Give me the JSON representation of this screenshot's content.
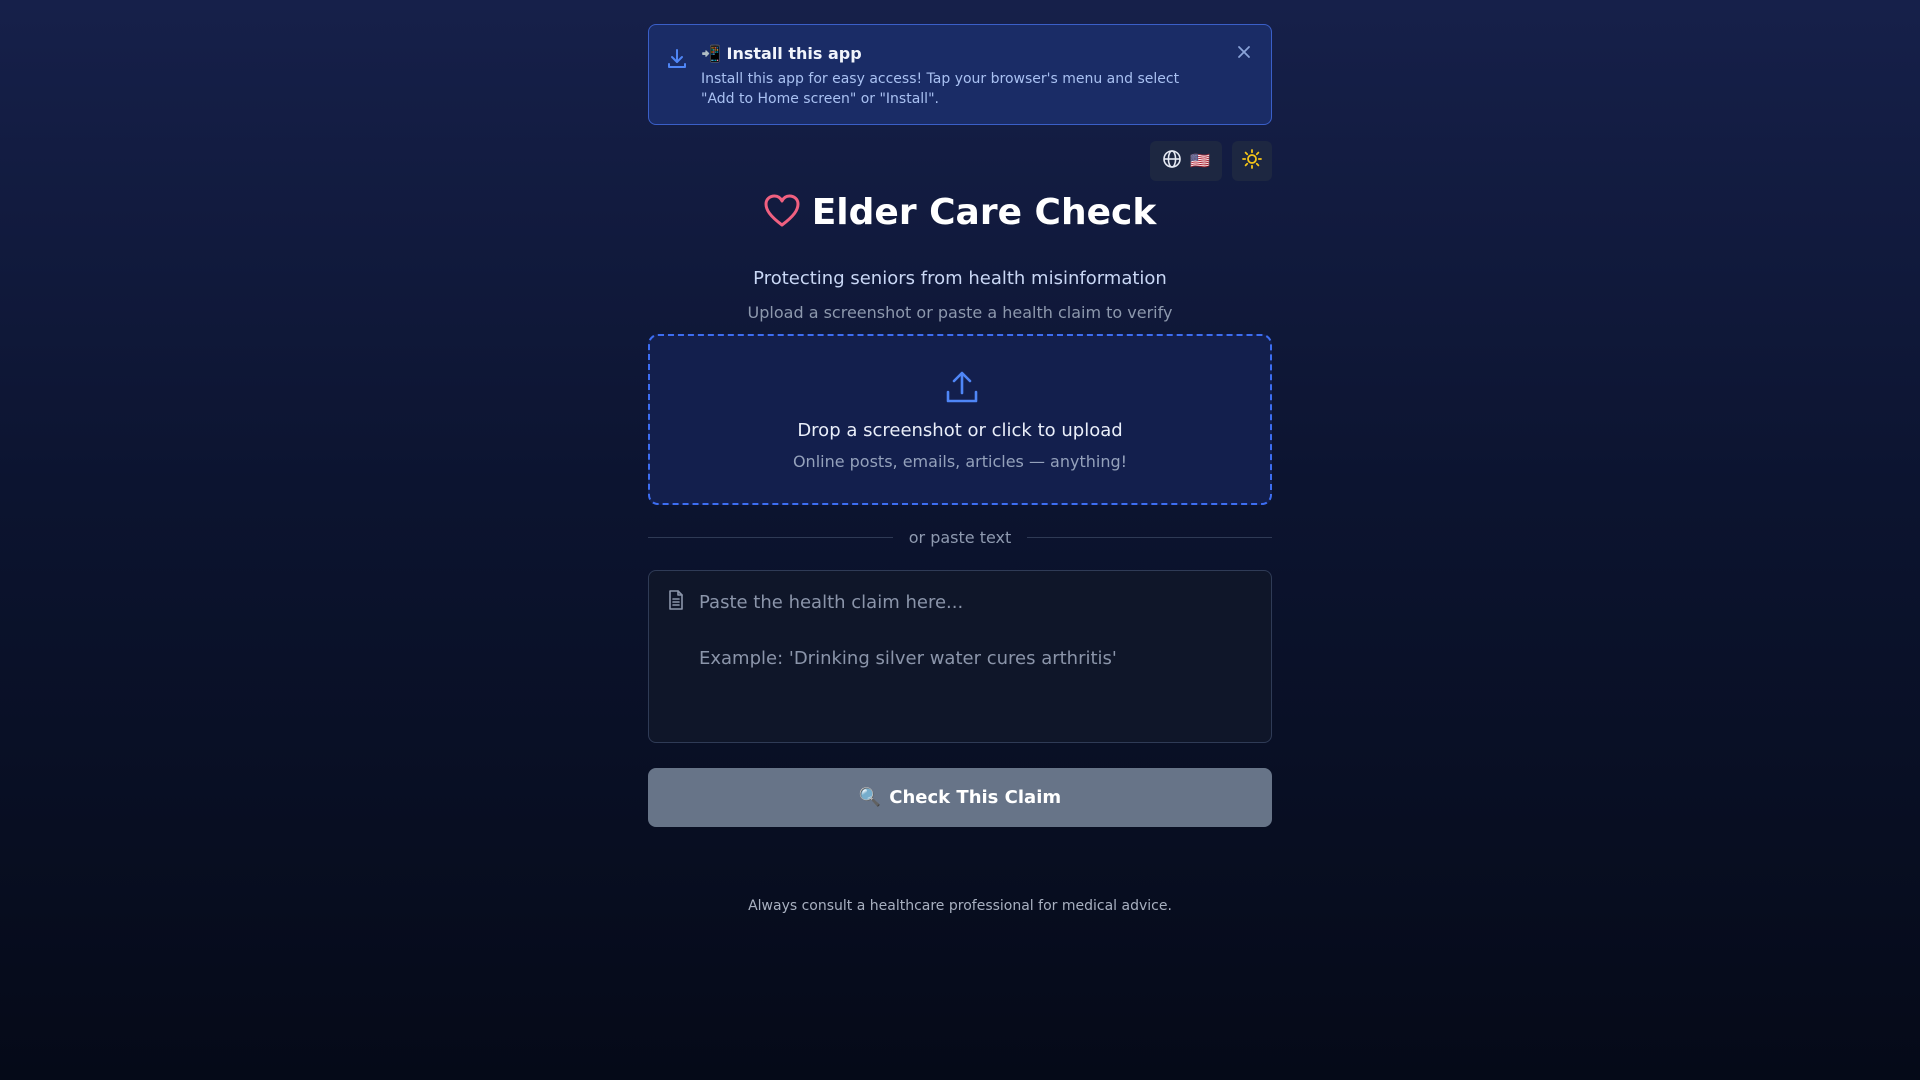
{
  "banner": {
    "icon": "download-icon",
    "title_emoji": "📲",
    "title": "Install this app",
    "text": "Install this app for easy access! Tap your browser's menu and select \"Add to Home screen\" or \"Install\".",
    "close_icon": "close-icon"
  },
  "controls": {
    "language_icon": "globe-icon",
    "language_flag": "🇺🇸",
    "theme_icon": "sun-icon"
  },
  "header": {
    "icon": "heart-icon",
    "title": "Elder Care Check",
    "subtitle": "Protecting seniors from health misinformation",
    "hint": "Upload a screenshot or paste a health claim to verify"
  },
  "upload": {
    "icon": "upload-icon",
    "title": "Drop a screenshot or click to upload",
    "subtitle": "Online posts, emails, articles — anything!"
  },
  "divider": {
    "label": "or paste text"
  },
  "claim": {
    "icon": "document-icon",
    "value": "",
    "placeholder": "Paste the health claim here...\n\nExample: 'Drinking silver water cures arthritis'"
  },
  "check_button": {
    "emoji": "🔍",
    "label": "Check This Claim"
  },
  "footer": {
    "note": "Always consult a healthcare professional for medical advice."
  },
  "colors": {
    "accent": "#3d6ef2",
    "heart": "#f06080",
    "sun": "#f5c518",
    "button_disabled": "#677488"
  }
}
